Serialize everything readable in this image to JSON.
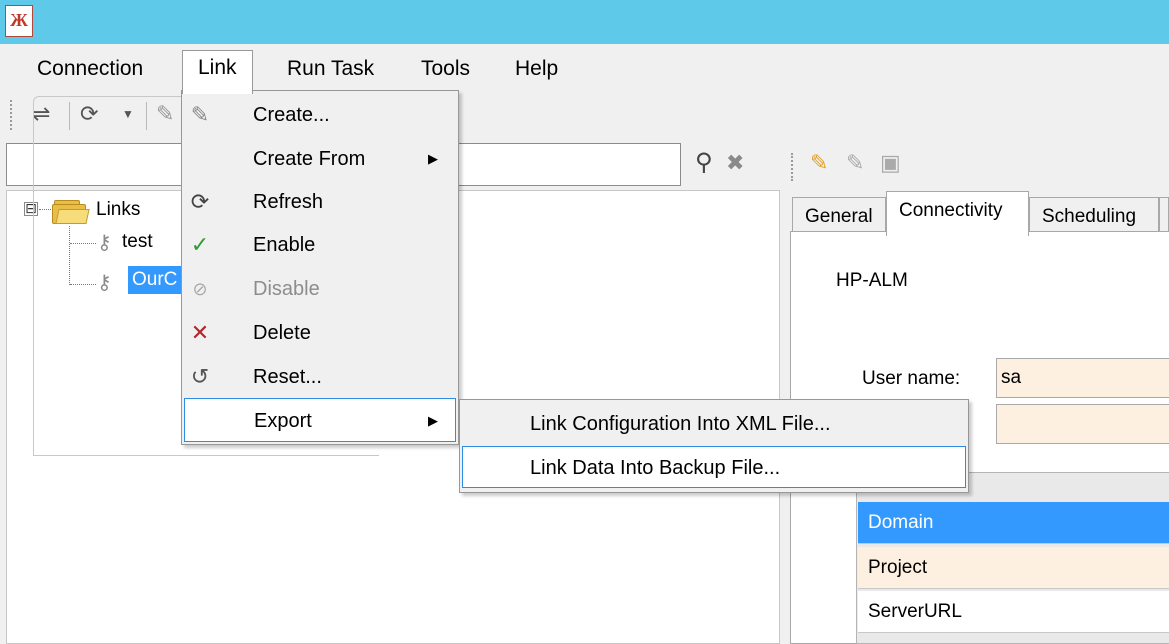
{
  "app": {
    "icon": "app-logo-icon",
    "logo_text": "Ж"
  },
  "menubar": {
    "items": [
      {
        "label": "Connection"
      },
      {
        "label": "Link"
      },
      {
        "label": "Run Task"
      },
      {
        "label": "Tools"
      },
      {
        "label": "Help"
      }
    ]
  },
  "toolbar": {
    "icons": [
      "sync-arrows-icon",
      "refresh-icon",
      "dropdown-icon",
      "create-link-icon"
    ]
  },
  "search": {
    "value": "",
    "icons": [
      "search-icon",
      "clear-icon"
    ]
  },
  "tree": {
    "root": {
      "label": "Links",
      "expander": "⊟"
    },
    "children": [
      {
        "label": "test"
      },
      {
        "label": "OurC"
      }
    ]
  },
  "link_menu": {
    "items": [
      {
        "label": "Create...",
        "icon": "create-icon",
        "state": "normal"
      },
      {
        "label": "Create From",
        "icon": "",
        "state": "normal",
        "submenu": true
      },
      {
        "label": "Refresh",
        "icon": "refresh-icon",
        "state": "normal"
      },
      {
        "label": "Enable",
        "icon": "check-icon",
        "state": "normal"
      },
      {
        "label": "Disable",
        "icon": "disable-icon",
        "state": "disabled"
      },
      {
        "label": "Delete",
        "icon": "delete-icon",
        "state": "normal"
      },
      {
        "label": "Reset...",
        "icon": "reset-icon",
        "state": "normal"
      },
      {
        "label": "Export",
        "icon": "",
        "state": "hover",
        "submenu": true
      }
    ]
  },
  "export_submenu": {
    "items": [
      {
        "label": "Link Configuration Into XML File..."
      },
      {
        "label": "Link Data Into Backup File..."
      }
    ]
  },
  "right_toolbar": {
    "icons": [
      "edit-icon",
      "edit-disabled-icon",
      "save-icon"
    ]
  },
  "details": {
    "tabs": [
      {
        "label": "General"
      },
      {
        "label": "Connectivity"
      },
      {
        "label": "Scheduling"
      }
    ],
    "active_tab": "Connectivity",
    "group_title": "HP-ALM",
    "username_label": "User name:",
    "username_value": "sa",
    "password_value": "",
    "grid_rows": [
      {
        "label": "Domain",
        "selected": true
      },
      {
        "label": "Project"
      },
      {
        "label": "ServerURL"
      }
    ]
  },
  "colors": {
    "titlebar": "#5fc9ea",
    "selection": "#3399ff",
    "menu_hover_border": "#2f8ce3",
    "field_background": "#fdf0e0",
    "menu_background": "#f0f0f0"
  }
}
